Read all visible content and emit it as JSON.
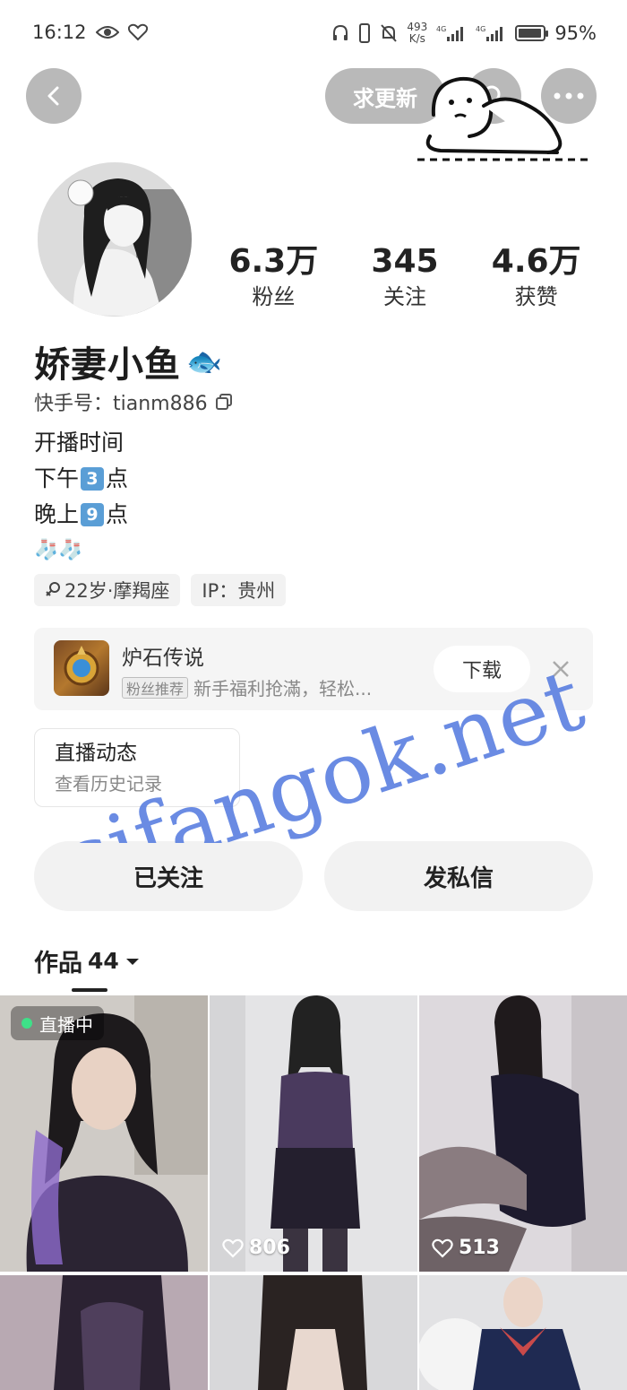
{
  "status_bar": {
    "time": "16:12",
    "net_speed_value": "493",
    "net_speed_unit": "K/s",
    "signal_1": "4G",
    "signal_2": "4G",
    "battery": "95%",
    "battery_level": 0.95
  },
  "nav": {
    "back_icon": "chevron-left-icon",
    "update_label": "求更新",
    "search_icon": "search-icon",
    "more_icon": "more-dots-icon"
  },
  "profile": {
    "stats": [
      {
        "value": "6.3万",
        "label": "粉丝"
      },
      {
        "value": "345",
        "label": "关注"
      },
      {
        "value": "4.6万",
        "label": "获赞"
      }
    ],
    "name": "娇妻小鱼",
    "name_emoji": "🐟",
    "id_text": "快手号：tianm886",
    "bio": {
      "line1": "开播时间",
      "line2_prefix": "下午",
      "line2_key": "3",
      "line2_suffix": "点",
      "line3_prefix": "晚上",
      "line3_key": "9",
      "line3_suffix": "点",
      "line4": "🧦🧦"
    },
    "tags": [
      "22岁·摩羯座",
      "IP：贵州"
    ]
  },
  "ad": {
    "title": "炉石传说",
    "badge": "粉丝推荐",
    "subtitle": "新手福利抢滿，轻松...",
    "download_label": "下载"
  },
  "live_history": {
    "title": "直播动态",
    "subtitle": "查看历史记录"
  },
  "actions": {
    "follow_label": "已关注",
    "message_label": "发私信"
  },
  "works": {
    "label": "作品",
    "count": "44"
  },
  "grid": [
    {
      "badge": "直播中",
      "likes": ""
    },
    {
      "badge": "",
      "likes": "806"
    },
    {
      "badge": "",
      "likes": "513"
    },
    {
      "badge": "",
      "likes": ""
    },
    {
      "badge": "",
      "likes": ""
    },
    {
      "badge": "",
      "likes": ""
    }
  ],
  "watermark": "sifangok.net",
  "colors": {
    "nav_button_bg": "#b9b9b9",
    "button_bg": "#f2f2f2",
    "keycap": "#5a9ed6",
    "watermark": "#5a7fe0",
    "live_dot": "#3ee088"
  }
}
